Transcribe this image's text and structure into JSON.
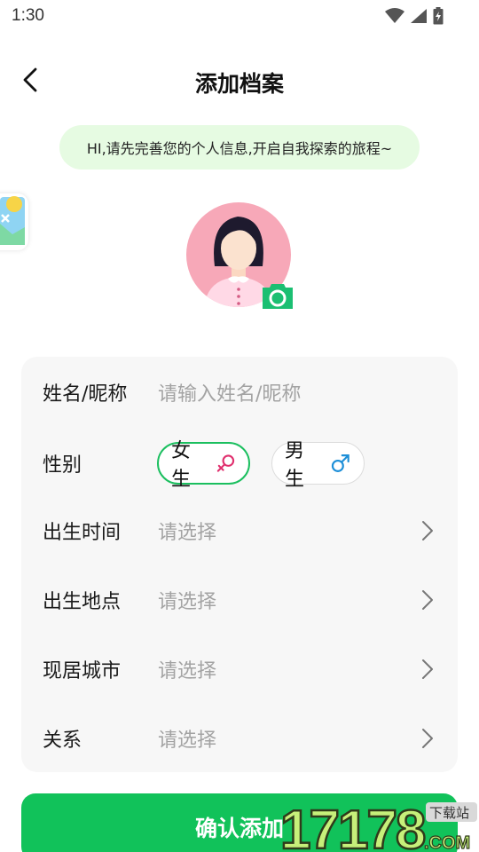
{
  "status": {
    "time": "1:30",
    "icons": [
      "wifi-icon",
      "signal-icon",
      "battery-charging-icon"
    ]
  },
  "nav": {
    "title": "添加档案",
    "back_icon": "chevron-left-icon"
  },
  "hint": "HI,请先完善您的个人信息,开启自我探索的旅程~",
  "avatar": {
    "camera_icon": "camera-icon"
  },
  "form": {
    "name": {
      "label": "姓名/昵称",
      "placeholder": "请输入姓名/昵称"
    },
    "gender": {
      "label": "性别",
      "female": "女生",
      "male": "男生",
      "selected": "女生"
    },
    "birth_time": {
      "label": "出生时间",
      "value": "请选择"
    },
    "birth_place": {
      "label": "出生地点",
      "value": "请选择"
    },
    "current_city": {
      "label": "现居城市",
      "value": "请选择"
    },
    "relation": {
      "label": "关系",
      "value": "请选择"
    }
  },
  "confirm_label": "确认添加",
  "watermark": {
    "number": "17178",
    "suffix": ".COM",
    "tag": "下载站"
  },
  "colors": {
    "accent": "#11c25a",
    "pill_bg": "#e6fbe2",
    "female_icon": "#e0306e",
    "male_icon": "#1d8fd8",
    "avatar_bg": "#f7a8b8"
  }
}
